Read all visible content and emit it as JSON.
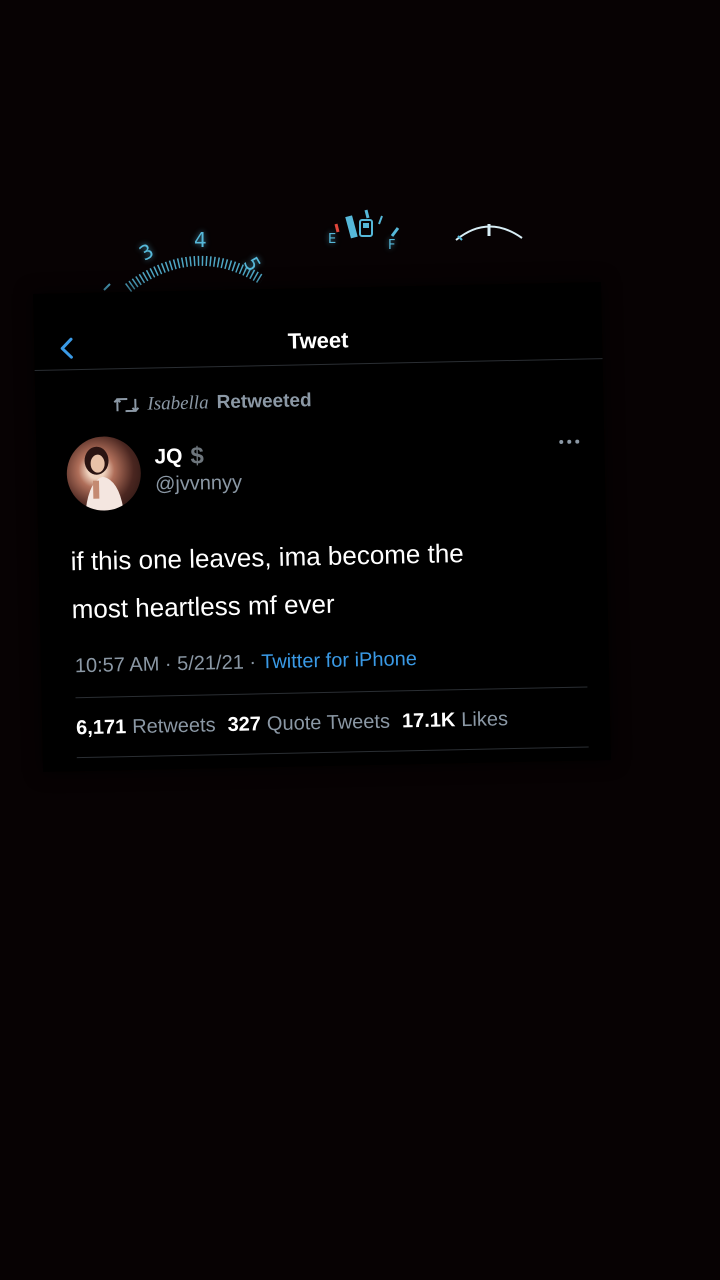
{
  "dashboard": {
    "speed_numbers": [
      "3",
      "4",
      "5"
    ],
    "fuel_empty": "E",
    "fuel_full": "F"
  },
  "topbar": {
    "title": "Tweet"
  },
  "retweet": {
    "name": "Isabella",
    "label": "Retweeted"
  },
  "tweet": {
    "display_name": "JQ",
    "badge": "$",
    "handle": "@jvvnnyy",
    "text_line1": "if this one leaves, ima become the",
    "text_line2": "most heartless mf ever",
    "time": "10:57 AM · 5/21/21 · ",
    "source": "Twitter for iPhone"
  },
  "stats": {
    "retweets_count": "6,171",
    "retweets_label": "Retweets",
    "quotes_count": "327",
    "quotes_label": "Quote Tweets",
    "likes_count": "17.1K",
    "likes_label": "Likes"
  },
  "colors": {
    "background": "#070203",
    "card": "#000000",
    "accent": "#3a9ae6",
    "dash_glow": "#56b8d9",
    "fuel_red": "#e0453a"
  }
}
